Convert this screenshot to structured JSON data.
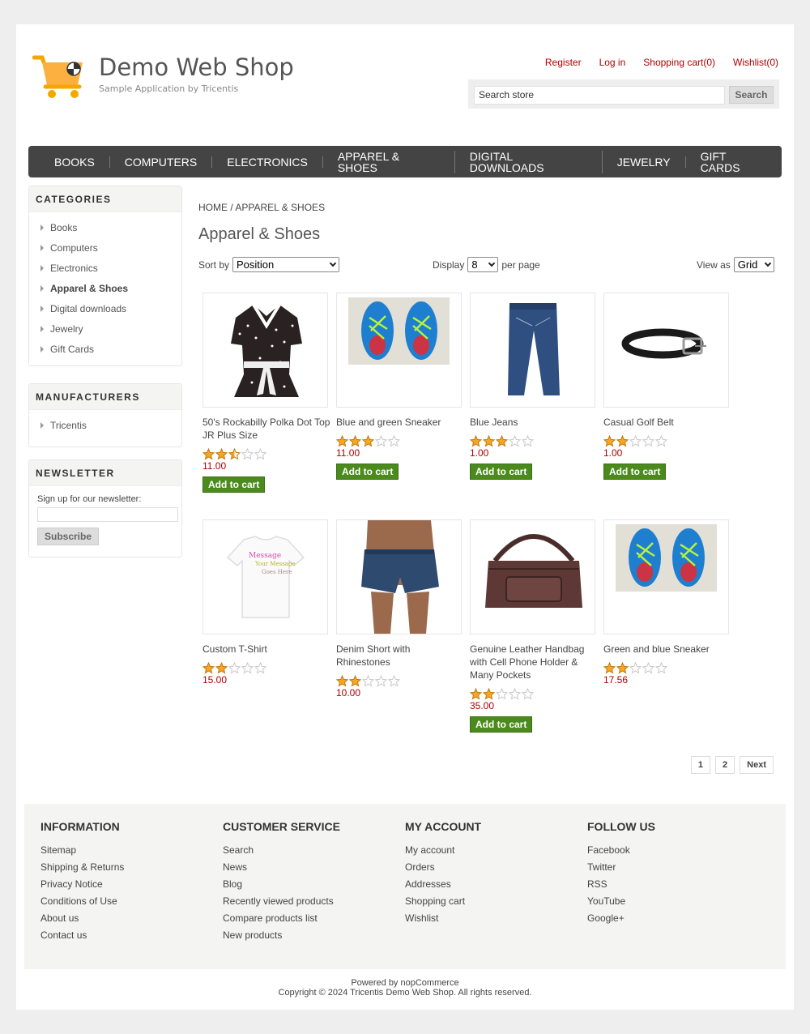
{
  "header": {
    "title": "Demo Web Shop",
    "subtitle": "Sample Application by Tricentis",
    "links": [
      "Register",
      "Log in",
      "Shopping cart(0)",
      "Wishlist(0)"
    ],
    "search_value": "Search store",
    "search_button": "Search"
  },
  "menu": [
    "BOOKS",
    "COMPUTERS",
    "ELECTRONICS",
    "APPAREL & SHOES",
    "DIGITAL DOWNLOADS",
    "JEWELRY",
    "GIFT CARDS"
  ],
  "categories": {
    "title": "CATEGORIES",
    "items": [
      "Books",
      "Computers",
      "Electronics",
      "Apparel & Shoes",
      "Digital downloads",
      "Jewelry",
      "Gift Cards"
    ]
  },
  "manufacturers": {
    "title": "MANUFACTURERS",
    "items": [
      "Tricentis"
    ]
  },
  "newsletter": {
    "title": "NEWSLETTER",
    "label": "Sign up for our newsletter:",
    "button": "Subscribe"
  },
  "breadcrumb": {
    "home": "HOME",
    "sep": "/",
    "current": "APPAREL & SHOES"
  },
  "page_title": "Apparel & Shoes",
  "sort": {
    "label": "Sort by",
    "value": "Position"
  },
  "display": {
    "label": "Display",
    "value": "8",
    "suffix": "per page"
  },
  "view": {
    "label": "View as",
    "value": "Grid"
  },
  "products": [
    {
      "name": "50's Rockabilly Polka Dot Top JR Plus Size",
      "price": "11.00",
      "rating": 2.5,
      "cart": "Add to cart",
      "icon": "blouse-image"
    },
    {
      "name": "Blue and green Sneaker",
      "price": "11.00",
      "rating": 3,
      "cart": "Add to cart",
      "icon": "sneaker-image"
    },
    {
      "name": "Blue Jeans",
      "price": "1.00",
      "rating": 3,
      "cart": "Add to cart",
      "icon": "jeans-image"
    },
    {
      "name": "Casual Golf Belt",
      "price": "1.00",
      "rating": 2,
      "cart": "Add to cart",
      "icon": "belt-image"
    },
    {
      "name": "Custom T-Shirt",
      "price": "15.00",
      "rating": 2,
      "cart": "",
      "icon": "tshirt-image"
    },
    {
      "name": "Denim Short with Rhinestones",
      "price": "10.00",
      "rating": 2,
      "cart": "",
      "icon": "shorts-image"
    },
    {
      "name": "Genuine Leather Handbag with Cell Phone Holder & Many Pockets",
      "price": "35.00",
      "rating": 2,
      "cart": "Add to cart",
      "icon": "handbag-image"
    },
    {
      "name": "Green and blue Sneaker",
      "price": "17.56",
      "rating": 2,
      "cart": "",
      "icon": "sneaker-image"
    }
  ],
  "pager": [
    "1",
    "2",
    "Next"
  ],
  "footer": {
    "information": {
      "title": "INFORMATION",
      "links": [
        "Sitemap",
        "Shipping & Returns",
        "Privacy Notice",
        "Conditions of Use",
        "About us",
        "Contact us"
      ]
    },
    "customer_service": {
      "title": "CUSTOMER SERVICE",
      "links": [
        "Search",
        "News",
        "Blog",
        "Recently viewed products",
        "Compare products list",
        "New products"
      ]
    },
    "my_account": {
      "title": "MY ACCOUNT",
      "links": [
        "My account",
        "Orders",
        "Addresses",
        "Shopping cart",
        "Wishlist"
      ]
    },
    "follow_us": {
      "title": "FOLLOW US",
      "links": [
        "Facebook",
        "Twitter",
        "RSS",
        "YouTube",
        "Google+"
      ]
    },
    "powered": "Powered by nopCommerce",
    "copyright": "Copyright © 2024 Tricentis Demo Web Shop. All rights reserved."
  },
  "colors": {
    "accent_red": "#b00000",
    "menu_bg": "#444444",
    "cart_green": "#4b8a1c",
    "star": "#f5a623"
  }
}
